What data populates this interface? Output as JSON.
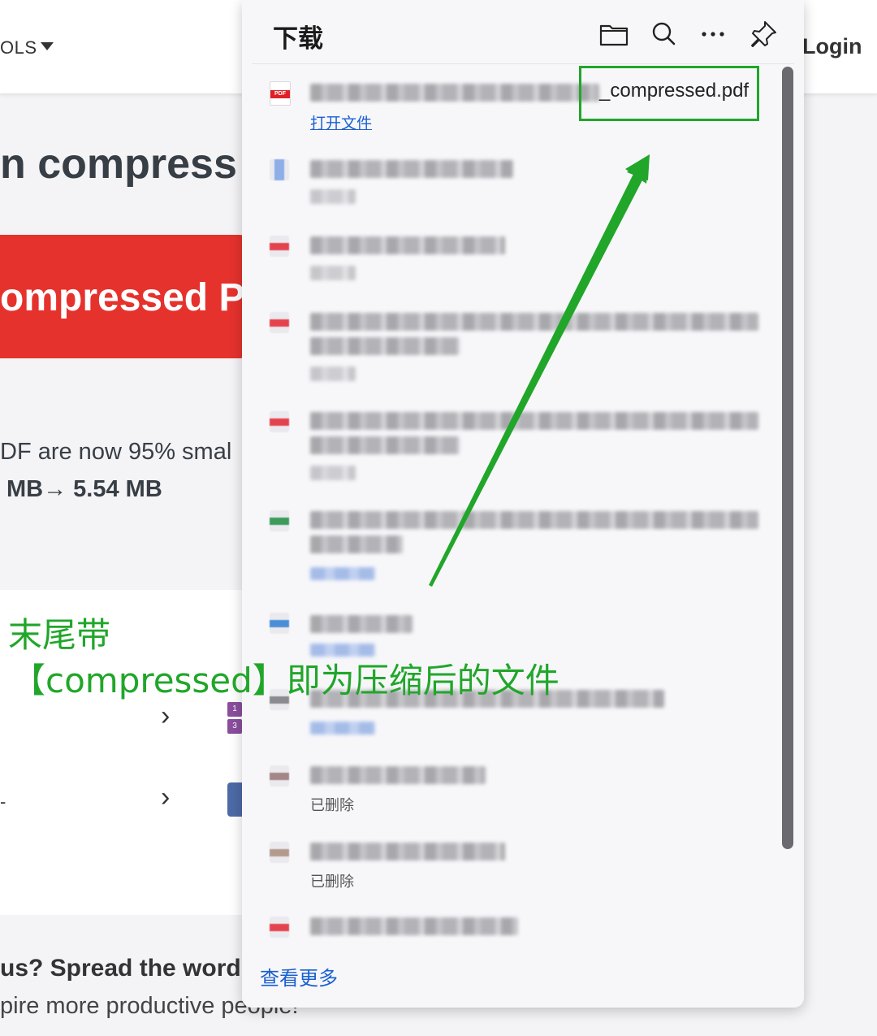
{
  "page": {
    "tools_label": "OLS",
    "login": "Login",
    "heading": "n compress",
    "banner_text": "ompressed PD",
    "result_line1": "DF are now 95% smal",
    "result_line2": "MB→ 5.54 MB",
    "spread_text": "us? Spread the word!",
    "inspire_text": "pire more productive people!",
    "dash_fragment": "-",
    "chevron": "›",
    "purple_icon_digits": [
      "1",
      "3"
    ]
  },
  "downloads": {
    "title": "下载",
    "icons": [
      "folder-icon",
      "search-icon",
      "more-icon",
      "pin-icon"
    ],
    "first_item": {
      "filename_visible": "_compressed.pdf",
      "icon_label": "PDF",
      "open_label": "打开文件"
    },
    "deleted_label": "已删除",
    "see_more": "查看更多",
    "colors": {
      "link": "#1a5fd0",
      "pdf_red": "#e11f26"
    }
  },
  "annotation": {
    "line1": "末尾带",
    "line2": "【compressed】即为压缩后的文件",
    "color": "#21a62a"
  }
}
